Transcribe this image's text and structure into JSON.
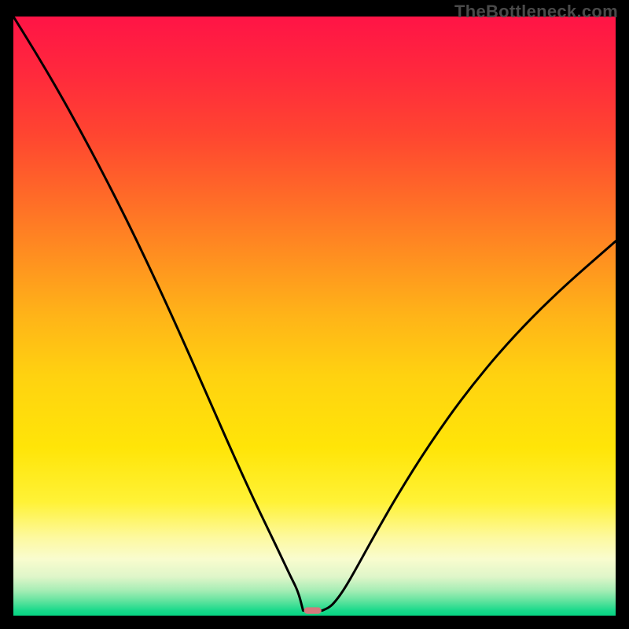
{
  "watermark": {
    "text": "TheBottleneck.com"
  },
  "colors": {
    "frame": "#000000",
    "watermark": "#4a4a4a",
    "curve": "#000000",
    "marker": "#d47a7d",
    "gradient_stops": [
      {
        "offset": 0.0,
        "color": "#ff1446"
      },
      {
        "offset": 0.1,
        "color": "#ff2a3c"
      },
      {
        "offset": 0.2,
        "color": "#ff4630"
      },
      {
        "offset": 0.3,
        "color": "#ff6a28"
      },
      {
        "offset": 0.4,
        "color": "#ff8f20"
      },
      {
        "offset": 0.5,
        "color": "#ffb418"
      },
      {
        "offset": 0.6,
        "color": "#ffd210"
      },
      {
        "offset": 0.72,
        "color": "#ffe508"
      },
      {
        "offset": 0.81,
        "color": "#fff236"
      },
      {
        "offset": 0.87,
        "color": "#fdf9a0"
      },
      {
        "offset": 0.905,
        "color": "#f9fcce"
      },
      {
        "offset": 0.935,
        "color": "#dff6c9"
      },
      {
        "offset": 0.958,
        "color": "#a6edb5"
      },
      {
        "offset": 0.976,
        "color": "#5fe39e"
      },
      {
        "offset": 0.992,
        "color": "#17d98a"
      },
      {
        "offset": 1.0,
        "color": "#07d584"
      }
    ]
  },
  "chart_data": {
    "type": "line",
    "title": "",
    "xlabel": "",
    "ylabel": "",
    "xlim": [
      0,
      100
    ],
    "ylim": [
      0,
      100
    ],
    "legend": false,
    "grid": false,
    "series": [
      {
        "name": "bottleneck-curve",
        "x": [
          0.0,
          3.7,
          7.4,
          11.1,
          14.8,
          18.5,
          22.2,
          25.9,
          29.6,
          33.3,
          37.0,
          40.0,
          42.5,
          44.5,
          46.0,
          47.3,
          48.4,
          49.3,
          51.2,
          52.5,
          53.5,
          55.0,
          57.0,
          60.0,
          64.0,
          69.0,
          75.0,
          82.0,
          90.0,
          100.0
        ],
        "y": [
          100.0,
          94.0,
          87.7,
          81.0,
          74.0,
          66.7,
          59.0,
          51.0,
          42.7,
          34.2,
          25.8,
          19.2,
          14.0,
          9.8,
          6.6,
          4.0,
          2.1,
          0.9,
          0.9,
          1.4,
          2.4,
          4.5,
          8.0,
          13.5,
          20.5,
          28.5,
          37.0,
          45.5,
          53.7,
          62.5
        ]
      }
    ],
    "flat_bottom": {
      "x_start": 48.1,
      "x_end": 51.3,
      "y": 0.85
    },
    "marker": {
      "x_center": 49.7,
      "y": 0.85,
      "half_width_x": 1.45,
      "radius_y": 0.55
    }
  }
}
